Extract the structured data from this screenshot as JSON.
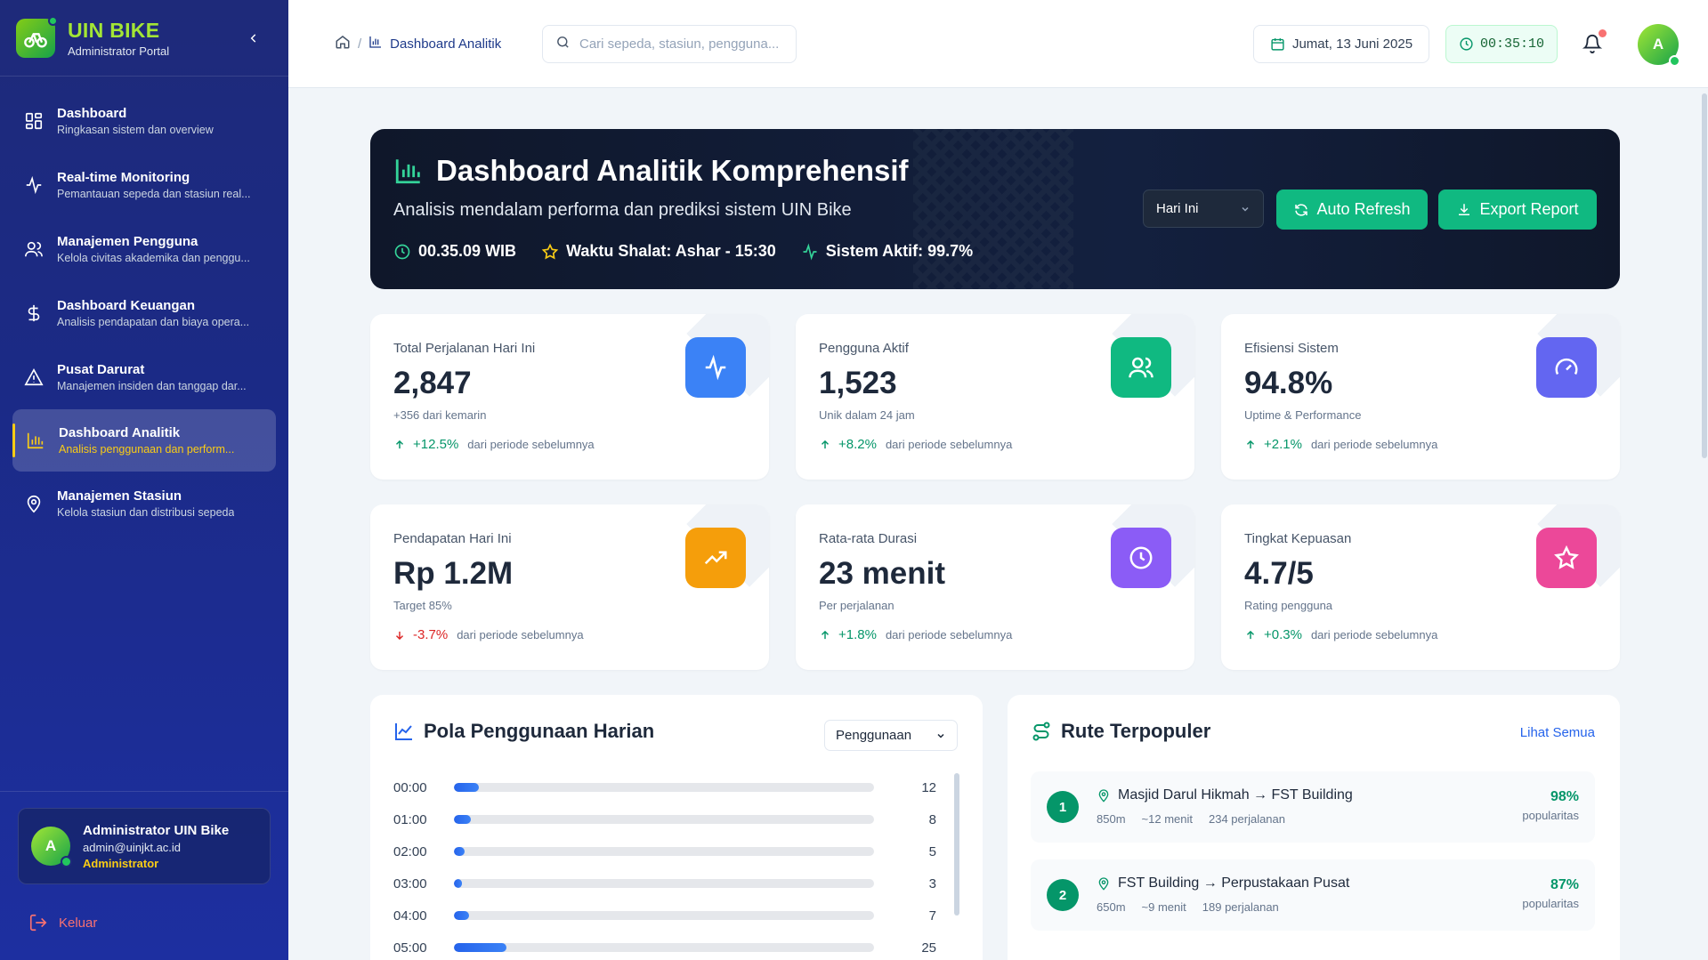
{
  "brand": {
    "title": "UIN BIKE",
    "subtitle": "Administrator Portal"
  },
  "sidebar": {
    "items": [
      {
        "label": "Dashboard",
        "desc": "Ringkasan sistem dan overview",
        "icon": "grid-icon"
      },
      {
        "label": "Real-time Monitoring",
        "desc": "Pemantauan sepeda dan stasiun real...",
        "icon": "activity-icon"
      },
      {
        "label": "Manajemen Pengguna",
        "desc": "Kelola civitas akademika dan penggu...",
        "icon": "users-icon"
      },
      {
        "label": "Dashboard Keuangan",
        "desc": "Analisis pendapatan dan biaya opera...",
        "icon": "dollar-icon"
      },
      {
        "label": "Pusat Darurat",
        "desc": "Manajemen insiden dan tanggap dar...",
        "icon": "alert-triangle-icon"
      },
      {
        "label": "Dashboard Analitik",
        "desc": "Analisis penggunaan dan perform...",
        "icon": "bar-chart-icon",
        "active": true
      },
      {
        "label": "Manajemen Stasiun",
        "desc": "Kelola stasiun dan distribusi sepeda",
        "icon": "map-pin-icon"
      }
    ],
    "user": {
      "initial": "A",
      "name": "Administrator UIN Bike",
      "email": "admin@uinjkt.ac.id",
      "role": "Administrator"
    },
    "logout_label": "Keluar"
  },
  "topbar": {
    "breadcrumb_current": "Dashboard Analitik",
    "search_placeholder": "Cari sepeda, stasiun, pengguna...",
    "date": "Jumat, 13 Juni 2025",
    "clock": "00:35:10",
    "avatar_initial": "A"
  },
  "hero": {
    "title": "Dashboard Analitik Komprehensif",
    "subtitle": "Analisis mendalam performa dan prediksi sistem UIN Bike",
    "time": "00.35.09 WIB",
    "prayer": "Waktu Shalat: Ashar - 15:30",
    "system": "Sistem Aktif: 99.7%",
    "period": "Hari Ini",
    "refresh_label": "Auto Refresh",
    "export_label": "Export Report"
  },
  "stats": [
    {
      "title": "Total Perjalanan Hari Ini",
      "value": "2,847",
      "sub": "+356 dari kemarin",
      "trend": "+12.5%",
      "trend_label": "dari periode sebelumnya",
      "up": true,
      "icon": "activity-icon",
      "color": "#3b82f6"
    },
    {
      "title": "Pengguna Aktif",
      "value": "1,523",
      "sub": "Unik dalam 24 jam",
      "trend": "+8.2%",
      "trend_label": "dari periode sebelumnya",
      "up": true,
      "icon": "users-icon",
      "color": "#10b981"
    },
    {
      "title": "Efisiensi Sistem",
      "value": "94.8%",
      "sub": "Uptime & Performance",
      "trend": "+2.1%",
      "trend_label": "dari periode sebelumnya",
      "up": true,
      "icon": "gauge-icon",
      "color": "#6366f1"
    },
    {
      "title": "Pendapatan Hari Ini",
      "value": "Rp 1.2M",
      "sub": "Target 85%",
      "trend": "-3.7%",
      "trend_label": "dari periode sebelumnya",
      "up": false,
      "icon": "trending-up-icon",
      "color": "#f59e0b"
    },
    {
      "title": "Rata-rata Durasi",
      "value": "23 menit",
      "sub": "Per perjalanan",
      "trend": "+1.8%",
      "trend_label": "dari periode sebelumnya",
      "up": true,
      "icon": "clock-icon",
      "color": "#8b5cf6"
    },
    {
      "title": "Tingkat Kepuasan",
      "value": "4.7/5",
      "sub": "Rating pengguna",
      "trend": "+0.3%",
      "trend_label": "dari periode sebelumnya",
      "up": true,
      "icon": "star-icon",
      "color": "#ec4899"
    }
  ],
  "usage": {
    "title": "Pola Penggunaan Harian",
    "select": "Penggunaan",
    "rows": [
      {
        "hour": "00:00",
        "value": 12
      },
      {
        "hour": "01:00",
        "value": 8
      },
      {
        "hour": "02:00",
        "value": 5
      },
      {
        "hour": "03:00",
        "value": 3
      },
      {
        "hour": "04:00",
        "value": 7
      },
      {
        "hour": "05:00",
        "value": 25
      }
    ],
    "max": 200
  },
  "routes": {
    "title": "Rute Terpopuler",
    "see_all": "Lihat Semua",
    "items": [
      {
        "rank": "1",
        "name": "Masjid Darul Hikmah → FST Building",
        "distance": "850m",
        "duration": "~12 menit",
        "trips": "234 perjalanan",
        "pct": "98%",
        "pct_label": "popularitas"
      },
      {
        "rank": "2",
        "name": "FST Building → Perpustakaan Pusat",
        "distance": "650m",
        "duration": "~9 menit",
        "trips": "189 perjalanan",
        "pct": "87%",
        "pct_label": "popularitas"
      }
    ]
  }
}
